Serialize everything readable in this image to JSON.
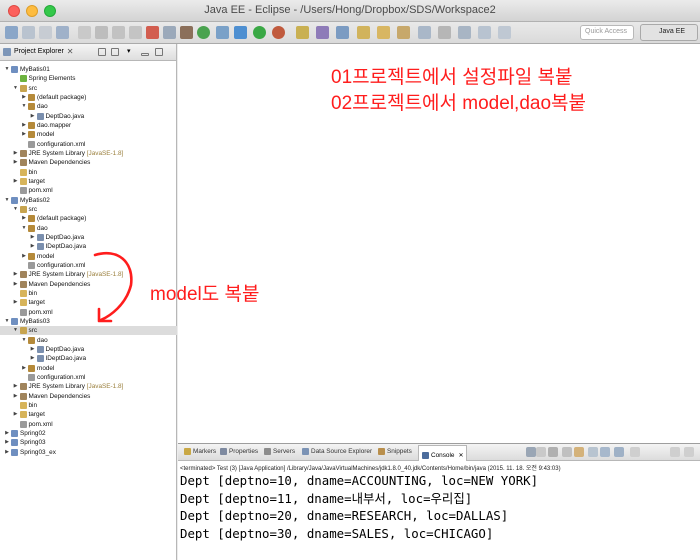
{
  "window": {
    "title": "Java EE - Eclipse - /Users/Hong/Dropbox/SDS/Workspace2"
  },
  "toolbar": {
    "quick_access_placeholder": "Quick Access",
    "perspective": "Java EE"
  },
  "explorer": {
    "tab_label": "Project Explorer",
    "tree": [
      {
        "label": "MyBatis01",
        "icon": "project-icon",
        "twisty": "▼"
      },
      {
        "label": "Spring Elements",
        "icon": "spring-icon",
        "twisty": ""
      },
      {
        "label": "src",
        "icon": "src-folder-icon",
        "twisty": "▼"
      },
      {
        "label": "(default package)",
        "icon": "package-icon",
        "twisty": "▶"
      },
      {
        "label": "dao",
        "icon": "package-icon",
        "twisty": "▼"
      },
      {
        "label": "DeptDao.java",
        "icon": "java-file-icon",
        "twisty": "▶"
      },
      {
        "label": "dao.mapper",
        "icon": "package-icon",
        "twisty": "▶"
      },
      {
        "label": "model",
        "icon": "package-icon",
        "twisty": "▶"
      },
      {
        "label": "configuration.xml",
        "icon": "xml-file-icon",
        "twisty": ""
      },
      {
        "label": "JRE System Library",
        "decoration": "[JavaSE-1.8]",
        "icon": "library-icon",
        "twisty": "▶"
      },
      {
        "label": "Maven Dependencies",
        "icon": "library-icon",
        "twisty": "▶"
      },
      {
        "label": "bin",
        "icon": "folder-icon",
        "twisty": ""
      },
      {
        "label": "target",
        "icon": "folder-icon",
        "twisty": "▶"
      },
      {
        "label": "pom.xml",
        "icon": "xml-file-icon",
        "twisty": ""
      },
      {
        "label": "MyBatis02",
        "icon": "project-icon",
        "twisty": "▼"
      },
      {
        "label": "src",
        "icon": "src-folder-icon",
        "twisty": "▼"
      },
      {
        "label": "(default package)",
        "icon": "package-icon",
        "twisty": "▶"
      },
      {
        "label": "dao",
        "icon": "package-icon",
        "twisty": "▼"
      },
      {
        "label": "DeptDao.java",
        "icon": "java-file-icon",
        "twisty": "▶"
      },
      {
        "label": "IDeptDao.java",
        "icon": "java-file-icon",
        "twisty": "▶"
      },
      {
        "label": "model",
        "icon": "package-icon",
        "twisty": "▶"
      },
      {
        "label": "configuration.xml",
        "icon": "xml-file-icon",
        "twisty": ""
      },
      {
        "label": "JRE System Library",
        "decoration": "[JavaSE-1.8]",
        "icon": "library-icon",
        "twisty": "▶"
      },
      {
        "label": "Maven Dependencies",
        "icon": "library-icon",
        "twisty": "▶"
      },
      {
        "label": "bin",
        "icon": "folder-icon",
        "twisty": ""
      },
      {
        "label": "target",
        "icon": "folder-icon",
        "twisty": "▶"
      },
      {
        "label": "pom.xml",
        "icon": "xml-file-icon",
        "twisty": ""
      },
      {
        "label": "MyBatis03",
        "icon": "project-icon",
        "twisty": "▼"
      },
      {
        "label": "src",
        "icon": "src-folder-icon",
        "twisty": "▼",
        "selected": true
      },
      {
        "label": "dao",
        "icon": "package-icon",
        "twisty": "▼"
      },
      {
        "label": "DeptDao.java",
        "icon": "java-file-icon",
        "twisty": "▶"
      },
      {
        "label": "IDeptDao.java",
        "icon": "java-file-icon",
        "twisty": "▶"
      },
      {
        "label": "model",
        "icon": "package-icon",
        "twisty": "▶"
      },
      {
        "label": "configuration.xml",
        "icon": "xml-file-icon",
        "twisty": ""
      },
      {
        "label": "JRE System Library",
        "decoration": "[JavaSE-1.8]",
        "icon": "library-icon",
        "twisty": "▶"
      },
      {
        "label": "Maven Dependencies",
        "icon": "library-icon",
        "twisty": "▶"
      },
      {
        "label": "bin",
        "icon": "folder-icon",
        "twisty": ""
      },
      {
        "label": "target",
        "icon": "folder-icon",
        "twisty": "▶"
      },
      {
        "label": "pom.xml",
        "icon": "xml-file-icon",
        "twisty": ""
      },
      {
        "label": "Spring02",
        "icon": "project-icon",
        "twisty": "▶"
      },
      {
        "label": "Spring03",
        "icon": "project-icon",
        "twisty": "▶"
      },
      {
        "label": "Spring03_ex",
        "icon": "project-icon",
        "twisty": "▶"
      }
    ]
  },
  "annotations": {
    "line1": "01프로젝트에서 설정파일 복붙",
    "line2": "02프로젝트에서 model,dao복붙",
    "model_note": "model도 복붙",
    "color": "#ff1d1d"
  },
  "console": {
    "tabs": [
      {
        "label": "Markers",
        "icon": "markers-icon"
      },
      {
        "label": "Properties",
        "icon": "properties-icon"
      },
      {
        "label": "Servers",
        "icon": "servers-icon"
      },
      {
        "label": "Data Source Explorer",
        "icon": "data-source-icon"
      },
      {
        "label": "Snippets",
        "icon": "snippets-icon"
      },
      {
        "label": "Console",
        "icon": "console-icon",
        "active": true
      }
    ],
    "status": "<terminated> Test (3) [Java Application] /Library/Java/JavaVirtualMachines/jdk1.8.0_40.jdk/Contents/Home/bin/java (2015. 11. 18. 오전 9:43:03)",
    "lines": [
      "Dept [deptno=10, dname=ACCOUNTING, loc=NEW YORK]",
      "Dept [deptno=11, dname=내부서, loc=우리집]",
      "Dept [deptno=20, dname=RESEARCH, loc=DALLAS]",
      "Dept [deptno=30, dname=SALES, loc=CHICAGO]"
    ]
  }
}
